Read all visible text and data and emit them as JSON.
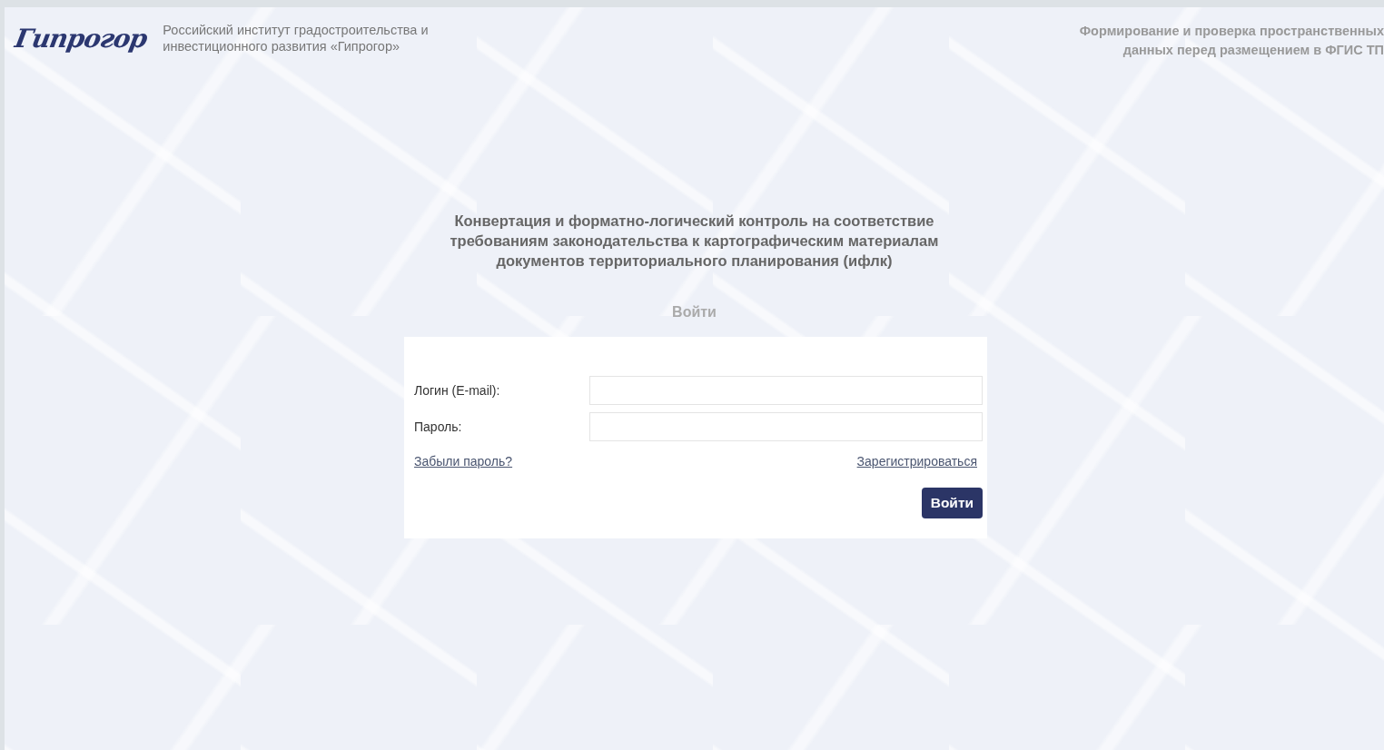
{
  "header": {
    "logo": "Гипрогор",
    "organization": "Российский институт градостроительства и инвестиционного развития «Гипрогор»",
    "service": "Формирование и проверка пространственных данных перед размещением в ФГИС ТП"
  },
  "main": {
    "title": "Конвертация и форматно-логический контроль на соответствие требованиям законодательства к картографическим материалам документов территориального планирования (ифлк)",
    "form_heading": "Войти"
  },
  "form": {
    "fields": [
      {
        "label": "Логин (E-mail):"
      },
      {
        "label": "Пароль:"
      }
    ],
    "forgot_link": "Забыли пароль?",
    "register_link": "Зарегистрироваться",
    "submit": "Войти"
  }
}
